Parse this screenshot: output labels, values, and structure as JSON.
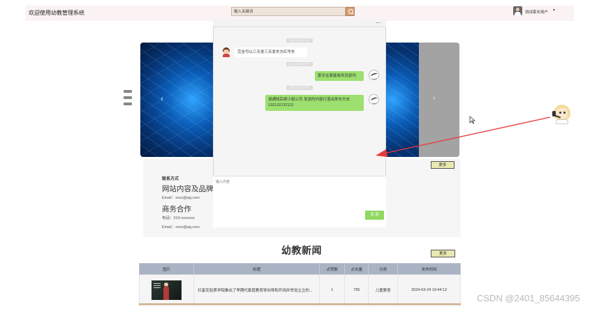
{
  "header": {
    "site_title": "欢迎使用幼教管理系统",
    "search_placeholder": "输入关键词",
    "user_name": "测试家长用户",
    "user_caret": "▾",
    "icons": {
      "search": "search-icon",
      "avatar": "user-avatar"
    }
  },
  "carousel": {
    "prev_label": "‹",
    "next_label": "›"
  },
  "contact": {
    "heading": "联系方式",
    "site_content": "网站内容及品牌合作",
    "site_email": "Email：xxxx@qq.com",
    "business": "商务合作",
    "phone": "电话：010-xxxxxxx",
    "business_email": "Email：xxxx@qq.com",
    "more_label": "更多"
  },
  "chat": {
    "minimize_label": "—",
    "timestamps": [
      "2024-05-16 17:50",
      "2024-05-16 17:52",
      "2024-05-16 17:53"
    ],
    "messages": [
      {
        "side": "left",
        "text": "完全可以三天发三天发东方红华东"
      },
      {
        "side": "right",
        "text": "家长在家能收到消息吗"
      },
      {
        "side": "right",
        "text": "请通知后续小组公司 发送的内容打造出来东方去 13213213213​1"
      }
    ],
    "input_placeholder": "输入内容",
    "send_label": "发 送"
  },
  "news": {
    "title": "幼教新闻",
    "more_label": "更多",
    "columns": [
      "图片",
      "标题",
      "点赞数",
      "点击量",
      "分类",
      "发布时间"
    ],
    "rows": [
      {
        "title": "红星实验首学院推出了早期代家庭教育导向导和开阔并举设立立的...",
        "likes": "1",
        "clicks": "795",
        "category": "儿童教育",
        "published": "2024-03-24 19:44:12"
      }
    ]
  },
  "watermark": "CSDN @2401_85644395",
  "colors": {
    "send_button": "#8fd862",
    "bubble_green": "#9de070",
    "table_header": "#a9b3c3",
    "more_button": "#e8e8b0",
    "search_button": "#d59d76"
  }
}
